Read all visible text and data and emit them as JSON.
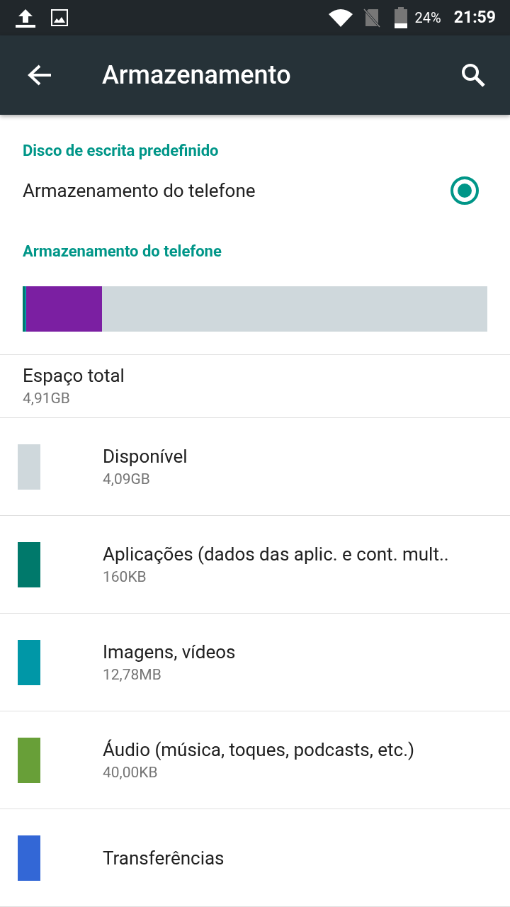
{
  "status_bar": {
    "battery": "24%",
    "time": "21:59"
  },
  "toolbar": {
    "title": "Armazenamento"
  },
  "default_disk": {
    "header": "Disco de escrita predefinido",
    "option": {
      "label": "Armazenamento do telefone",
      "selected": true
    }
  },
  "storage": {
    "header": "Armazenamento do telefone",
    "segments": [
      {
        "color": "#00796b",
        "level": 0.004
      },
      {
        "color": "#0097a7",
        "level": 0.004
      },
      {
        "color": "#7b1fa2",
        "level": 0.163
      }
    ]
  },
  "total": {
    "label": "Espaço total",
    "value": "4,91GB"
  },
  "items": [
    {
      "label": "Disponível",
      "value": "4,09GB",
      "color": "#cfd8dc"
    },
    {
      "label": "Aplicações (dados das aplic. e cont. mult..",
      "value": "160KB",
      "color": "#00796b"
    },
    {
      "label": "Imagens, vídeos",
      "value": "12,78MB",
      "color": "#0097a7"
    },
    {
      "label": "Áudio (música, toques, podcasts, etc.)",
      "value": "40,00KB",
      "color": "#689f38"
    },
    {
      "label": "Transferências",
      "color": "#3367d6"
    }
  ]
}
